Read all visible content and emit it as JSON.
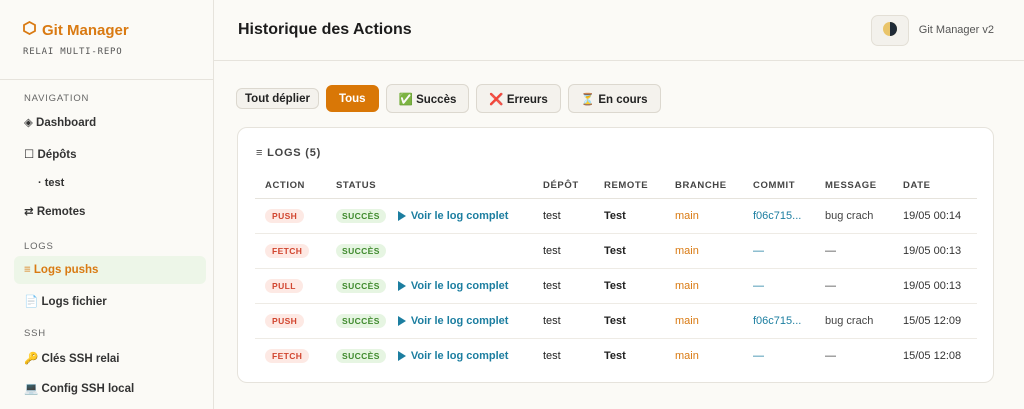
{
  "brand": {
    "icon": "hexagon-icon",
    "title": "Git Manager",
    "subtitle": "RELAI MULTI-REPO"
  },
  "sidebar": {
    "sections": {
      "navigation": "NAVIGATION",
      "logs": "LOGS",
      "ssh": "SSH"
    },
    "items": {
      "dashboard": "◈ Dashboard",
      "depots": "☐ Dépôts",
      "test": "· test",
      "remotes": "⇄ Remotes",
      "logs_pushs": "≡ Logs pushs",
      "logs_fichier": "📄 Logs fichier",
      "cles_ssh": "🔑 Clés SSH relai",
      "config_ssh": "💻 Config SSH local"
    }
  },
  "header": {
    "title": "Historique des Actions",
    "version": "Git Manager v2"
  },
  "filters": {
    "expand_all": "Tout déplier",
    "all": "Tous",
    "success": "✅ Succès",
    "errors": "❌ Erreurs",
    "in_progress": "⏳ En cours"
  },
  "logs": {
    "title": "≡ LOGS (5)",
    "columns": [
      "ACTION",
      "STATUS",
      "DÉPÔT",
      "REMOTE",
      "BRANCHE",
      "COMMIT",
      "MESSAGE",
      "DATE"
    ],
    "link_label": "Voir le log complet",
    "rows": [
      {
        "action": "PUSH",
        "status": "SUCCÈS",
        "has_log": true,
        "depot": "test",
        "remote": "Test",
        "branch": "main",
        "commit": "f06c715...",
        "message": "bug crach",
        "date": "19/05 00:14"
      },
      {
        "action": "FETCH",
        "status": "SUCCÈS",
        "has_log": false,
        "depot": "test",
        "remote": "Test",
        "branch": "main",
        "commit": "—",
        "message": "—",
        "date": "19/05 00:13"
      },
      {
        "action": "PULL",
        "status": "SUCCÈS",
        "has_log": true,
        "depot": "test",
        "remote": "Test",
        "branch": "main",
        "commit": "—",
        "message": "—",
        "date": "19/05 00:13"
      },
      {
        "action": "PUSH",
        "status": "SUCCÈS",
        "has_log": true,
        "depot": "test",
        "remote": "Test",
        "branch": "main",
        "commit": "f06c715...",
        "message": "bug crach",
        "date": "15/05 12:09"
      },
      {
        "action": "FETCH",
        "status": "SUCCÈS",
        "has_log": true,
        "depot": "test",
        "remote": "Test",
        "branch": "main",
        "commit": "—",
        "message": "—",
        "date": "15/05 12:08"
      }
    ]
  },
  "colors": {
    "accent": "#d97706",
    "link": "#1c7ea0",
    "success": "#3f8a2d",
    "danger": "#d1452f"
  }
}
